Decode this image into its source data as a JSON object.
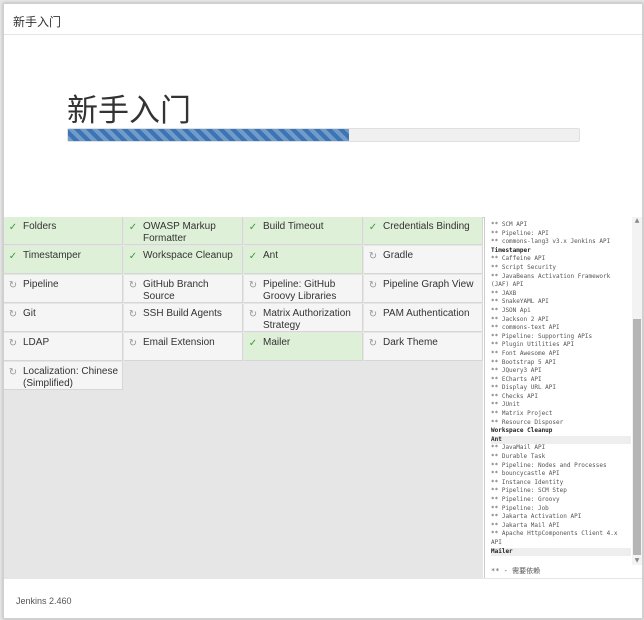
{
  "header": {
    "title": "新手入门"
  },
  "hero": {
    "title": "新手入门",
    "progress": 0.55
  },
  "plugins": [
    {
      "name": "Folders",
      "status": "ok"
    },
    {
      "name": "OWASP Markup Formatter",
      "status": "ok"
    },
    {
      "name": "Build Timeout",
      "status": "ok"
    },
    {
      "name": "Credentials Binding",
      "status": "ok"
    },
    {
      "name": "Timestamper",
      "status": "ok"
    },
    {
      "name": "Workspace Cleanup",
      "status": "ok"
    },
    {
      "name": "Ant",
      "status": "ok"
    },
    {
      "name": "Gradle",
      "status": "pending"
    },
    {
      "name": "Pipeline",
      "status": "pending"
    },
    {
      "name": "GitHub Branch Source",
      "status": "pending"
    },
    {
      "name": "Pipeline: GitHub Groovy Libraries",
      "status": "pending"
    },
    {
      "name": "Pipeline Graph View",
      "status": "pending"
    },
    {
      "name": "Git",
      "status": "pending"
    },
    {
      "name": "SSH Build Agents",
      "status": "pending"
    },
    {
      "name": "Matrix Authorization Strategy",
      "status": "pending"
    },
    {
      "name": "PAM Authentication",
      "status": "pending"
    },
    {
      "name": "LDAP",
      "status": "pending"
    },
    {
      "name": "Email Extension",
      "status": "pending"
    },
    {
      "name": "Mailer",
      "status": "ok"
    },
    {
      "name": "Dark Theme",
      "status": "pending"
    },
    {
      "name": "Localization: Chinese (Simplified)",
      "status": "pending"
    }
  ],
  "log": {
    "lines": [
      {
        "text": "** SCM API",
        "kind": "dep"
      },
      {
        "text": "** Pipeline: API",
        "kind": "dep"
      },
      {
        "text": "** commons-lang3 v3.x Jenkins API",
        "kind": "dep"
      },
      {
        "text": "Timestamper",
        "kind": "head"
      },
      {
        "text": "** Caffeine API",
        "kind": "dep"
      },
      {
        "text": "** Script Security",
        "kind": "dep"
      },
      {
        "text": "** JavaBeans Activation Framework",
        "kind": "dep"
      },
      {
        "text": "(JAF) API",
        "kind": "dep"
      },
      {
        "text": "** JAXB",
        "kind": "dep"
      },
      {
        "text": "** SnakeYAML API",
        "kind": "dep"
      },
      {
        "text": "** JSON Api",
        "kind": "dep"
      },
      {
        "text": "** Jackson 2 API",
        "kind": "dep"
      },
      {
        "text": "** commons-text API",
        "kind": "dep"
      },
      {
        "text": "** Pipeline: Supporting APIs",
        "kind": "dep"
      },
      {
        "text": "** Plugin Utilities API",
        "kind": "dep"
      },
      {
        "text": "** Font Awesome API",
        "kind": "dep"
      },
      {
        "text": "** Bootstrap 5 API",
        "kind": "dep"
      },
      {
        "text": "** JQuery3 API",
        "kind": "dep"
      },
      {
        "text": "** ECharts API",
        "kind": "dep"
      },
      {
        "text": "** Display URL API",
        "kind": "dep"
      },
      {
        "text": "** Checks API",
        "kind": "dep"
      },
      {
        "text": "** JUnit",
        "kind": "dep"
      },
      {
        "text": "** Matrix Project",
        "kind": "dep"
      },
      {
        "text": "** Resource Disposer",
        "kind": "dep"
      },
      {
        "text": "Workspace Cleanup",
        "kind": "head"
      },
      {
        "text": "Ant",
        "kind": "headhl"
      },
      {
        "text": "** JavaMail API",
        "kind": "dep"
      },
      {
        "text": "** Durable Task",
        "kind": "dep"
      },
      {
        "text": "** Pipeline: Nodes and Processes",
        "kind": "dep"
      },
      {
        "text": "** bouncycastle API",
        "kind": "dep"
      },
      {
        "text": "** Instance Identity",
        "kind": "dep"
      },
      {
        "text": "** Pipeline: SCM Step",
        "kind": "dep"
      },
      {
        "text": "** Pipeline: Groovy",
        "kind": "dep"
      },
      {
        "text": "** Pipeline: Job",
        "kind": "dep"
      },
      {
        "text": "** Jakarta Activation API",
        "kind": "dep"
      },
      {
        "text": "** Jakarta Mail API",
        "kind": "dep"
      },
      {
        "text": "** Apache HttpComponents Client 4.x",
        "kind": "dep"
      },
      {
        "text": "API",
        "kind": "dep"
      },
      {
        "text": "Mailer",
        "kind": "headhl"
      }
    ],
    "footer_note": "** - 需要依赖"
  },
  "footer": {
    "version": "Jenkins 2.460"
  },
  "icons": {
    "ok": "✓",
    "pending": "↻"
  },
  "colors": {
    "ok_bg": "#dff0d8",
    "pending_bg": "#f5f5f5",
    "progress": "#3b75b4"
  }
}
